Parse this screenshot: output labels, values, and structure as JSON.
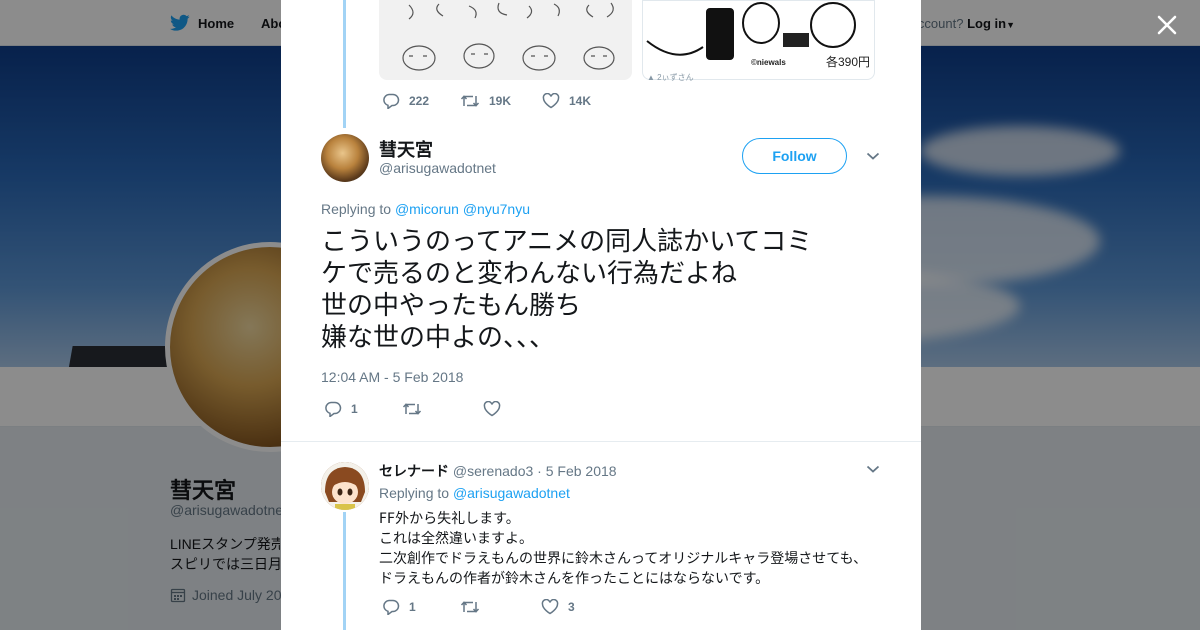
{
  "background": {
    "nav": {
      "home_label": "Home",
      "about_label": "Abo",
      "account_prompt": "ccount?",
      "login_label": "Log in"
    },
    "profile": {
      "name": "彗天宮",
      "handle": "@arisugawadotnet",
      "bio_line1": "LINEスタンプ発売",
      "bio_line2": "スピリでは三日月",
      "joined": "Joined July 20"
    }
  },
  "prev_tweet": {
    "image_price": "各390円",
    "image_brand": "©niewals",
    "image_credit": "2ぃずさん",
    "replies": "222",
    "retweets": "19K",
    "likes": "14K"
  },
  "main_tweet": {
    "name": "彗天宮",
    "handle": "@arisugawadotnet",
    "follow_label": "Follow",
    "replying_prefix": "Replying to",
    "replying_to": [
      "@micorun",
      "@nyu7nyu"
    ],
    "text_lines": [
      "こういうのってアニメの同人誌かいてコミ",
      "ケで売るのと変わんない行為だよね",
      "世の中やったもん勝ち",
      "嫌な世の中よの、、、"
    ],
    "timestamp": "12:04 AM - 5 Feb 2018",
    "replies": "1",
    "retweets": "",
    "likes": ""
  },
  "reply_tweet": {
    "name": "セレナード",
    "handle": "@serenado3",
    "date": "· 5 Feb 2018",
    "replying_prefix": "Replying to",
    "replying_to": "@arisugawadotnet",
    "text_lines": [
      "FF外から失礼します。",
      "これは全然違いますよ。",
      "二次創作でドラえもんの世界に鈴木さんってオリジナルキャラ登場させても、",
      "ドラえもんの作者が鈴木さんを作ったことにはならないです。"
    ],
    "replies": "1",
    "retweets": "",
    "likes": "3"
  },
  "colors": {
    "accent": "#1da1f2",
    "thread_line": "#a2d3f5",
    "text": "#14171a",
    "muted": "#657786"
  }
}
